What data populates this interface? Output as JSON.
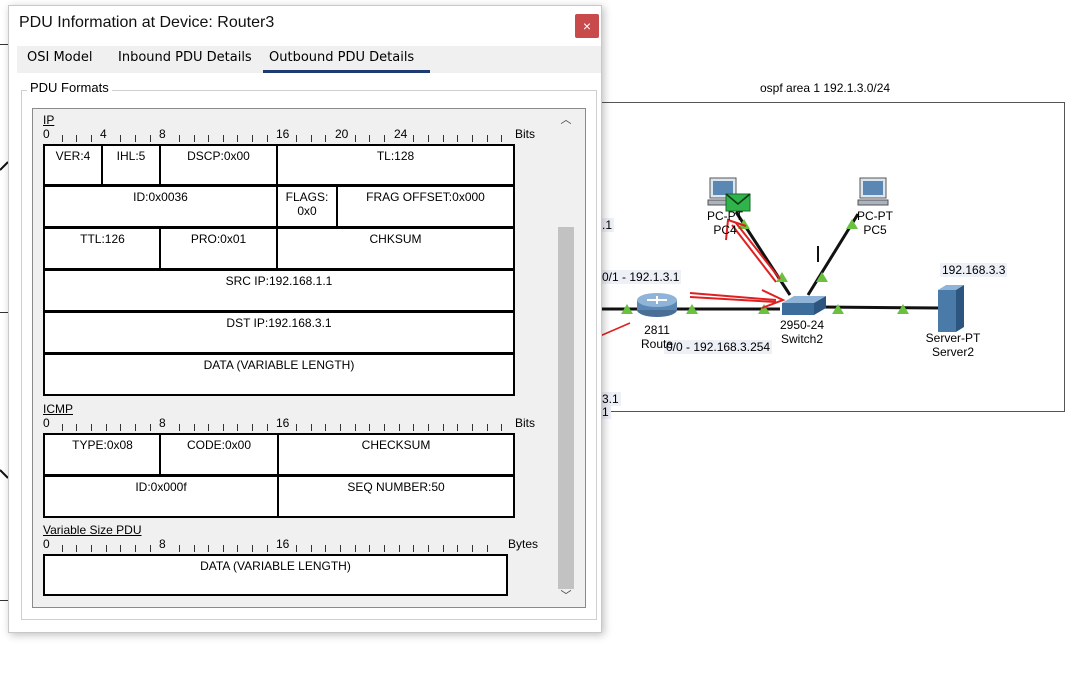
{
  "topology": {
    "area_label": "ospf area 1 192.1.3.0/24",
    "router": {
      "model": "2811",
      "name": "Route"
    },
    "switch": {
      "model": "2950-24",
      "name": "Switch2"
    },
    "pc4": {
      "type": "PC-PT",
      "name": "PC4"
    },
    "pc5": {
      "type": "PC-PT",
      "name": "PC5"
    },
    "server": {
      "type": "Server-PT",
      "name": "Server2",
      "ip": "192.168.3.3"
    },
    "iface_top": "0/1 - 192.1.3.1",
    "iface_bottom": "0/0 - 192.168.3.254",
    "frag_1": ".1",
    "frag_2": "3.1",
    "frag_3": "1",
    "frag_4": ".1"
  },
  "dialog": {
    "title": "PDU Information at Device: Router3",
    "close": "×",
    "tabs": [
      {
        "label": "OSI Model",
        "active": false
      },
      {
        "label": "Inbound PDU Details",
        "active": false
      },
      {
        "label": "Outbound PDU Details",
        "active": true
      }
    ],
    "group_label": "PDU Formats"
  },
  "pdu": {
    "ip": {
      "title": "IP",
      "unit": "Bits",
      "ruler_nums": [
        "0",
        "4",
        "8",
        "16",
        "20",
        "24"
      ],
      "fields": {
        "ver": "VER:4",
        "ihl": "IHL:5",
        "dscp": "DSCP:0x00",
        "tl": "TL:128",
        "id": "ID:0x0036",
        "flags_1": "FLAGS:",
        "flags_2": "0x0",
        "frag": "FRAG OFFSET:0x000",
        "ttl": "TTL:126",
        "pro": "PRO:0x01",
        "chksum": "CHKSUM",
        "src": "SRC IP:192.168.1.1",
        "dst": "DST IP:192.168.3.1",
        "data": "DATA (VARIABLE LENGTH)"
      }
    },
    "icmp": {
      "title": "ICMP",
      "unit": "Bits",
      "ruler_nums": [
        "0",
        "8",
        "16"
      ],
      "fields": {
        "type": "TYPE:0x08",
        "code": "CODE:0x00",
        "checksum": "CHECKSUM",
        "id": "ID:0x000f",
        "seq": "SEQ NUMBER:50"
      }
    },
    "var": {
      "title": "Variable Size PDU",
      "unit": "Bytes",
      "ruler_nums": [
        "0",
        "8",
        "16"
      ],
      "fields": {
        "data": "DATA (VARIABLE LENGTH)"
      }
    }
  },
  "colors": {
    "link": "#111111",
    "link_up": "#6ac13f",
    "packet_arrow": "#e02020",
    "dialog_close": "#c84a4a",
    "active_tab": "#1f3a73"
  }
}
